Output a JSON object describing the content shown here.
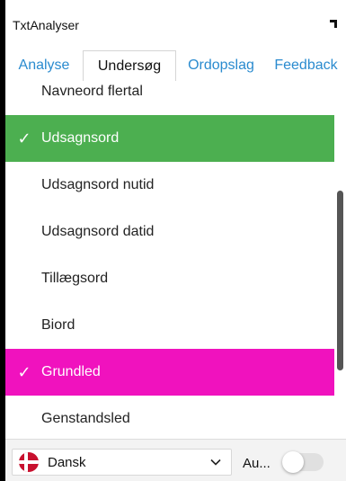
{
  "app": {
    "title": "TxtAnalyser"
  },
  "tabs": [
    {
      "label": "Analyse",
      "active": false
    },
    {
      "label": "Undersøg",
      "active": true
    },
    {
      "label": "Ordopslag",
      "active": false
    },
    {
      "label": "Feedback",
      "active": false
    }
  ],
  "list": {
    "items": [
      {
        "label": "Navneord flertal",
        "selected": false,
        "color": ""
      },
      {
        "label": "Udsagnsord",
        "selected": true,
        "color": "#4caf50"
      },
      {
        "label": "Udsagnsord nutid",
        "selected": false,
        "color": ""
      },
      {
        "label": "Udsagnsord datid",
        "selected": false,
        "color": ""
      },
      {
        "label": "Tillægsord",
        "selected": false,
        "color": ""
      },
      {
        "label": "Biord",
        "selected": false,
        "color": ""
      },
      {
        "label": "Grundled",
        "selected": true,
        "color": "#f012be"
      },
      {
        "label": "Genstandsled",
        "selected": false,
        "color": ""
      }
    ],
    "check_glyph": "✓"
  },
  "footer": {
    "language": "Dansk",
    "language_flag_icon": "denmark-flag-icon",
    "auto_label": "Au...",
    "auto_toggle_on": false
  },
  "colors": {
    "tab_link": "#2a8bcf",
    "selected_green": "#4caf50",
    "selected_magenta": "#f012be",
    "flag_red": "#c8102e"
  }
}
